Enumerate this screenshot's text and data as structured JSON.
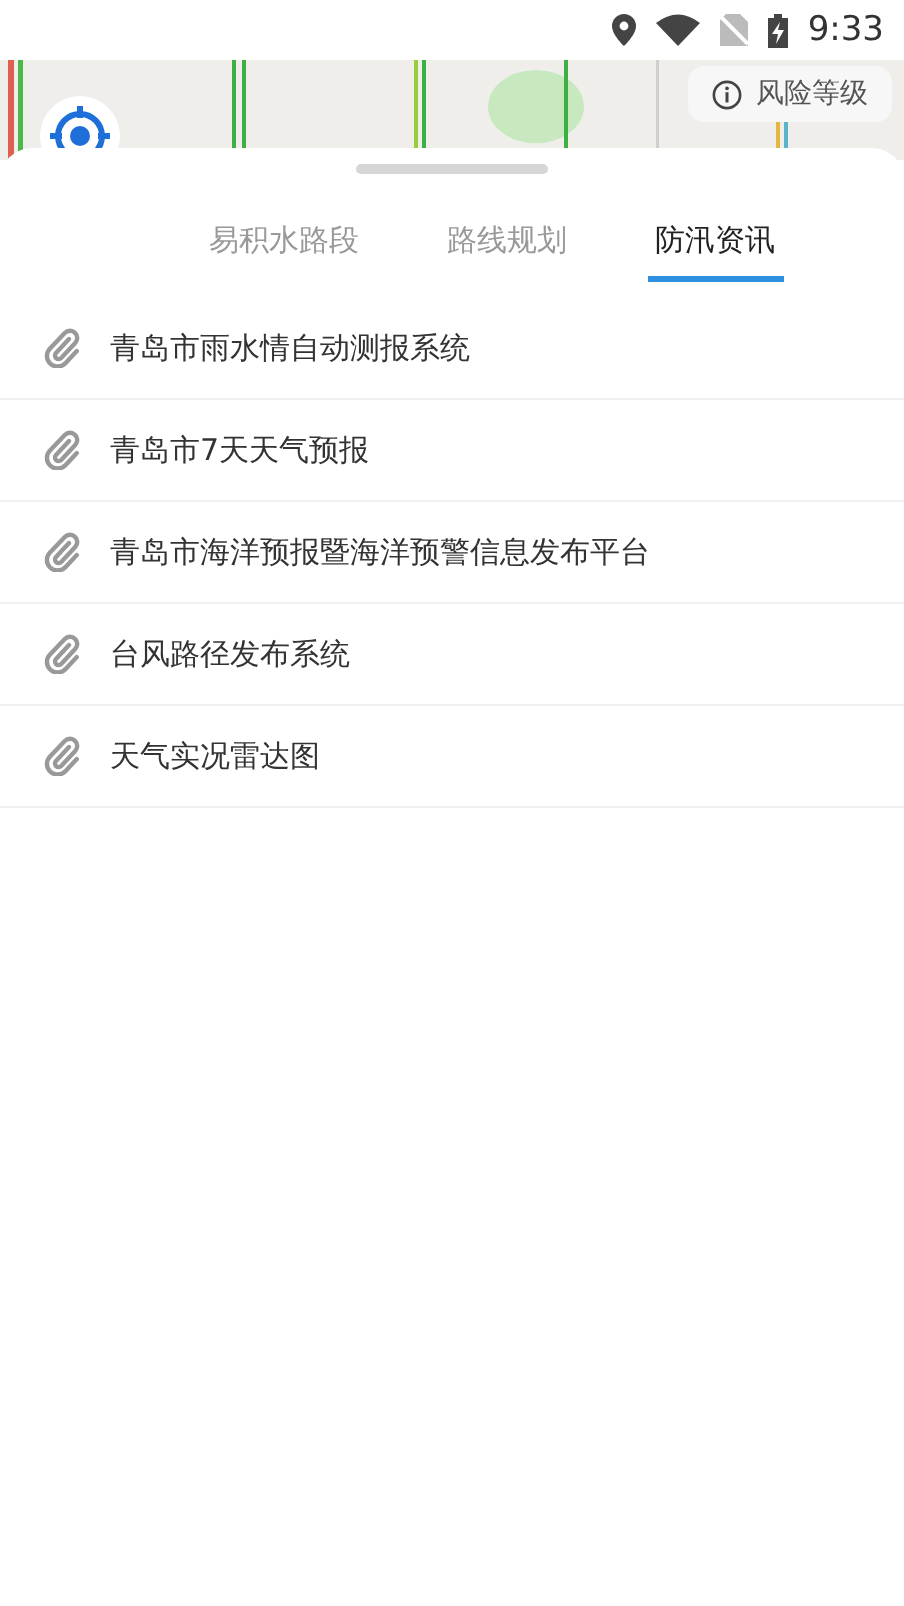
{
  "status_bar": {
    "time": "9:33"
  },
  "map": {
    "kind": "picture",
    "risk_button": {
      "label": "风险等级"
    }
  },
  "tabs": [
    {
      "label": "易积水路段",
      "selected": false
    },
    {
      "label": "路线规划",
      "selected": false
    },
    {
      "label": "防汛资讯",
      "selected": true
    }
  ],
  "links": [
    {
      "title": "青岛市雨水情自动测报系统"
    },
    {
      "title": "青岛市7天天气预报"
    },
    {
      "title": "青岛市海洋预报暨海洋预警信息发布平台"
    },
    {
      "title": "台风路径发布系统"
    },
    {
      "title": "天气实况雷达图"
    }
  ]
}
